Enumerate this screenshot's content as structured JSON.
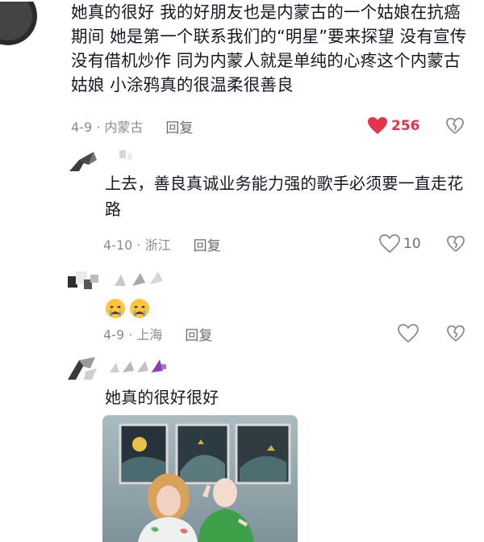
{
  "main_comment": {
    "text": "她真的很好 我的好朋友也是内蒙古的一个姑娘在抗癌期间 她是第一个联系我们的“明星”要来探望 没有宣传没有借机炒作 同为内蒙人就是单纯的心疼这个内蒙古姑娘 小涂鸦真的很温柔很善良",
    "date_location": "4-9 · 内蒙古",
    "reply_label": "回复",
    "like_count": "256",
    "like_color": "#e3344c"
  },
  "replies": [
    {
      "text": "上去，善良真诚业务能力强的歌手必须要一直走花路",
      "date_location": "4-10 · 浙江",
      "reply_label": "回复",
      "like_count": "10"
    },
    {
      "emoji": [
        "crying-face",
        "crying-face"
      ],
      "date_location": "4-9 · 上海",
      "reply_label": "回复",
      "like_count": ""
    },
    {
      "text": "她真的很好很好",
      "has_image": true
    }
  ],
  "icons": {
    "like": "heart-icon",
    "dislike": "broken-heart-icon"
  }
}
